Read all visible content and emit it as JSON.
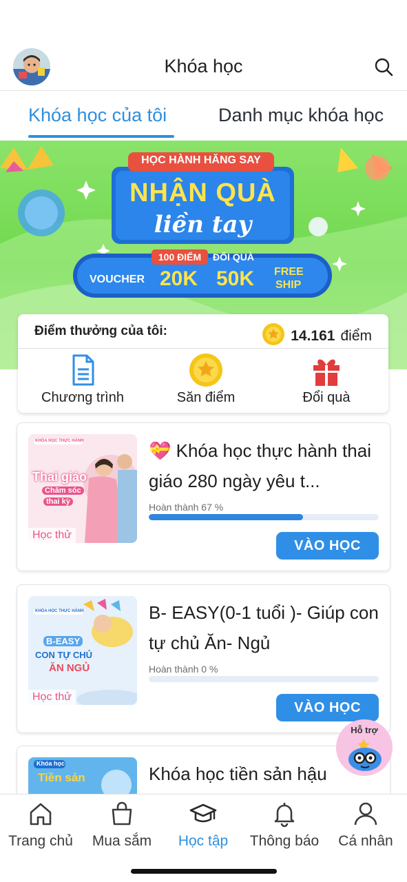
{
  "header": {
    "title": "Khóa học"
  },
  "tabs": [
    {
      "label": "Khóa học của tôi",
      "active": true
    },
    {
      "label": "Danh mục khóa học",
      "active": false
    }
  ],
  "banner": {
    "tagline": "HỌC HÀNH HĂNG SAY",
    "headline": "NHẬN QUÀ",
    "subheadline": "liền tay",
    "points_tag": "100 ĐIỂM",
    "redeem_tag": "ĐỔI QUÀ",
    "voucher": "VOUCHER",
    "amount1": "20K",
    "amount2": "50K",
    "free_ship": "FREE",
    "free_ship2": "SHIP"
  },
  "points": {
    "label": "Điểm thưởng của tôi:",
    "value": "14.161",
    "unit": "điểm",
    "actions": [
      {
        "label": "Chương trình",
        "icon": "document-icon"
      },
      {
        "label": "Săn điểm",
        "icon": "star-coin-icon"
      },
      {
        "label": "Đổi quà",
        "icon": "gift-icon"
      }
    ]
  },
  "courses": [
    {
      "title": "💝 Khóa học thực hành thai giáo 280 ngày yêu t...",
      "progress_label": "Hoàn thành 67 %",
      "progress": 0.67,
      "trial": "Học thử",
      "button": "VÀO HỌC",
      "thumb": {
        "badge": "KHÓA HỌC THỰC HÀNH",
        "line1": "Thai giáo",
        "line2": "Chăm sóc",
        "line3": "thai kỳ"
      }
    },
    {
      "title": "B- EASY(0-1 tuổi )- Giúp con  tự chủ Ăn- Ngủ",
      "progress_label": "Hoàn thành 0 %",
      "progress": 0,
      "trial": "Học thử",
      "button": "VÀO HỌC",
      "thumb": {
        "badge": "KHÓA HỌC THỰC HÀNH",
        "line1": "B-EASY",
        "line2": "CON TỰ CHỦ",
        "line3": "ĂN NGỦ"
      }
    },
    {
      "title": "Khóa học tiền sản hậu",
      "thumb": {
        "badge": "Khóa học",
        "line1": "Tiền sản"
      }
    }
  ],
  "help": {
    "label": "Hỗ trợ"
  },
  "nav": [
    {
      "label": "Trang chủ",
      "icon": "home-icon",
      "active": false
    },
    {
      "label": "Mua sắm",
      "icon": "shopping-bag-icon",
      "active": false
    },
    {
      "label": "Học tập",
      "icon": "graduation-cap-icon",
      "active": true
    },
    {
      "label": "Thông báo",
      "icon": "bell-icon",
      "active": false
    },
    {
      "label": "Cá nhân",
      "icon": "user-icon",
      "active": false
    }
  ],
  "colors": {
    "primary": "#2f8fe6",
    "banner_green": "#7ade55",
    "gift_red": "#e23c3c",
    "coin_yellow": "#f5c518"
  }
}
